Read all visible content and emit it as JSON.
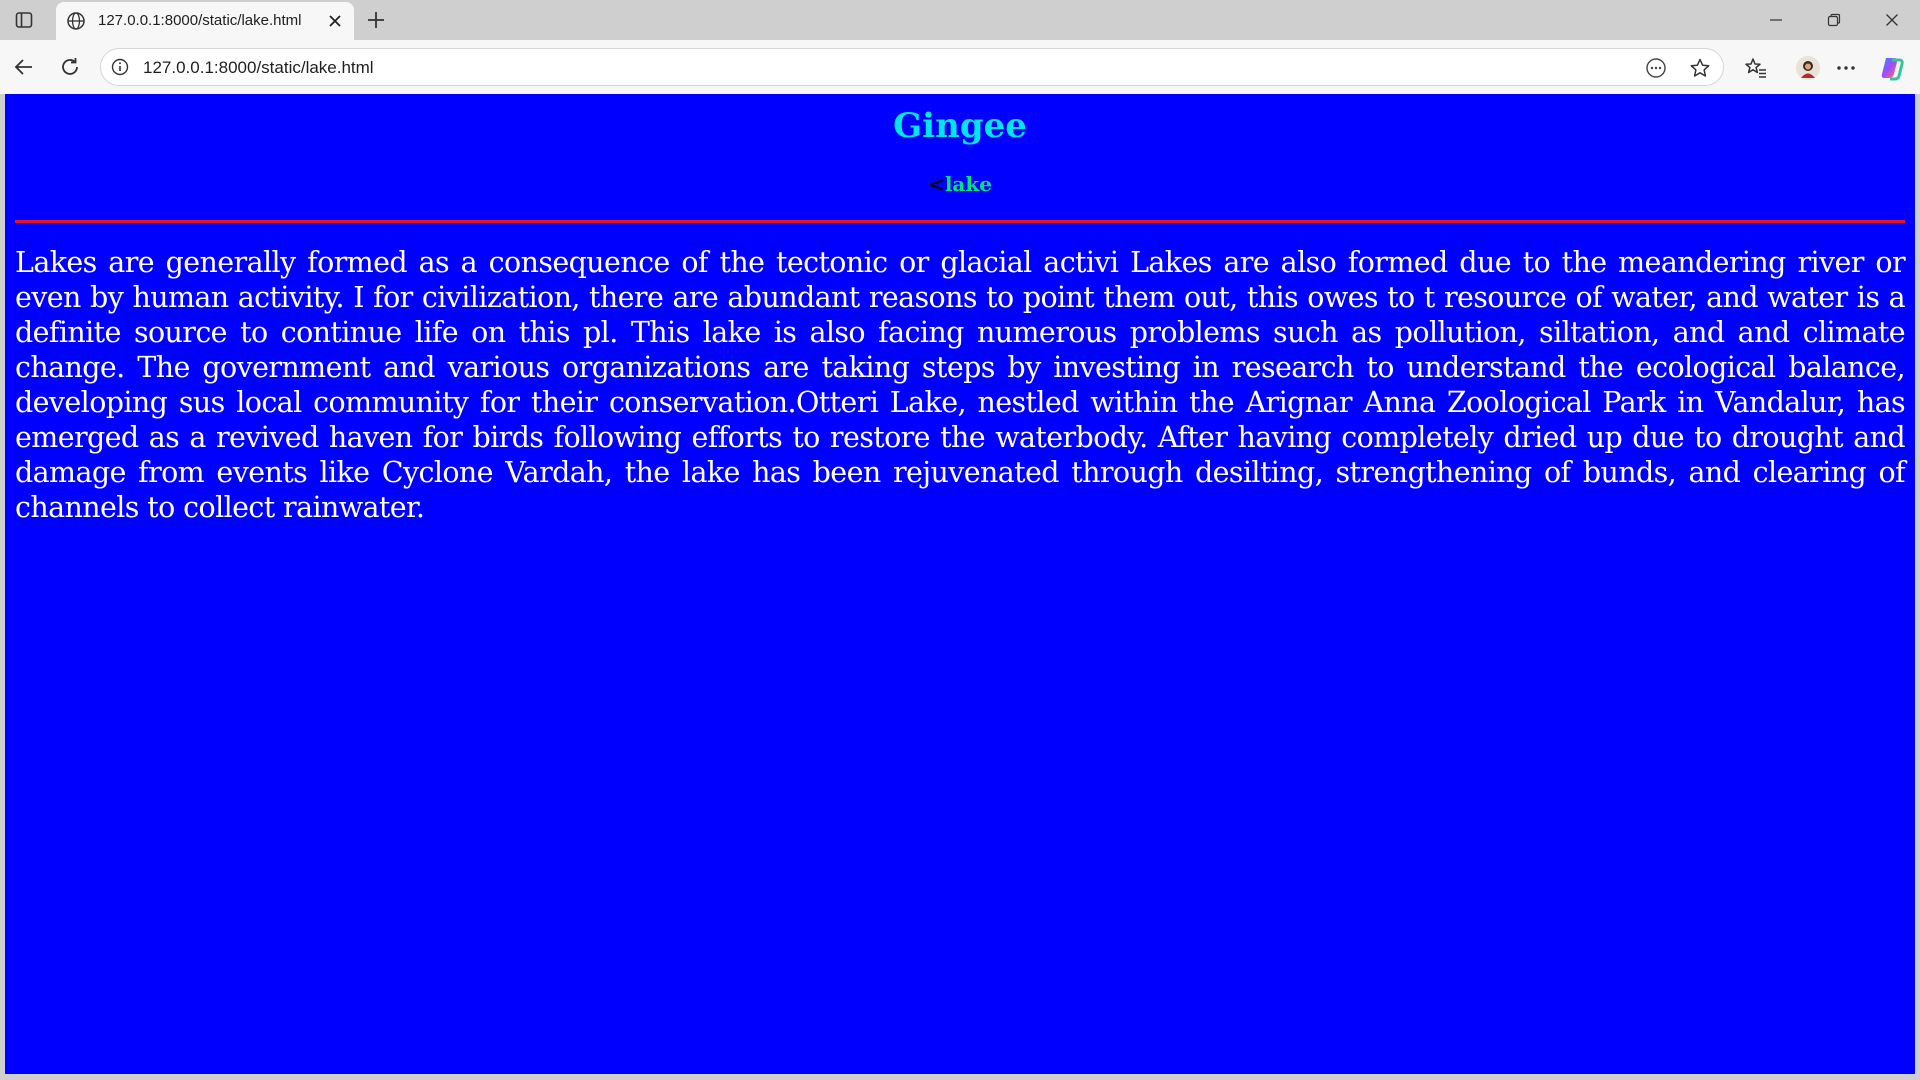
{
  "browser": {
    "tab_title": "127.0.0.1:8000/static/lake.html",
    "url": "127.0.0.1:8000/static/lake.html",
    "icons": {
      "sidebar": "sidebar-toggle-icon",
      "globe": "globe-icon",
      "close": "close-icon",
      "new_tab": "plus-icon",
      "back": "back-arrow-icon",
      "reload": "reload-icon",
      "info": "info-icon",
      "reader": "reader-mode-icon",
      "star": "star-icon",
      "favorites": "favorites-icon",
      "profile": "profile-avatar",
      "more": "more-icon",
      "copilot": "copilot-icon"
    }
  },
  "page": {
    "title": "Gingee",
    "subtitle_prefix": "<",
    "subtitle": "lake",
    "paragraph": "Lakes are generally formed as a consequence of the tectonic or glacial activi Lakes are also formed due to the meandering river or even by human activity. I for civilization, there are abundant reasons to point them out, this owes to t resource of water, and water is a definite source to continue life on this pl. This lake is also facing numerous problems such as pollution, siltation, and and climate change. The government and various organizations are taking steps by investing in research to understand the ecological balance, developing sus local community for their conservation.Otteri Lake, nestled within the Arignar Anna Zoological Park in Vandalur, has emerged as a revived haven for birds following efforts to restore the waterbody. After having completely dried up due to drought and damage from events like Cyclone Vardah, the lake has been rejuvenated through desilting, strengthening of bunds, and clearing of channels to collect rainwater."
  },
  "colors": {
    "page_background": "#0000ff",
    "title": "#00e5ee",
    "subtitle": "#00e676",
    "divider": "#e0152b",
    "body_text": "#ffffff"
  }
}
